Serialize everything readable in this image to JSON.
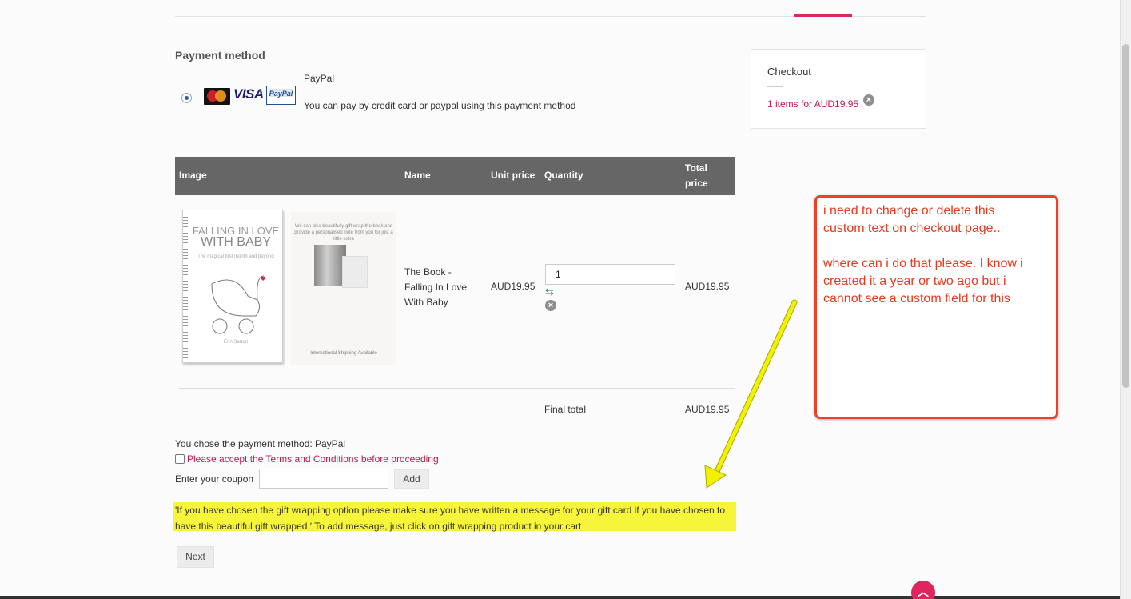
{
  "payment": {
    "title": "Payment method",
    "method_name": "PayPal",
    "method_desc": "You can pay by credit card or paypal using this payment method",
    "logos": {
      "mastercard": "MasterCard",
      "visa": "VISA",
      "paypal": "PayPal"
    }
  },
  "checkout_box": {
    "title": "Checkout",
    "items": "1 items for AUD19.95"
  },
  "table": {
    "headers": {
      "image": "Image",
      "name": "Name",
      "unit_price": "Unit price",
      "quantity": "Quantity",
      "total_line1": "Total",
      "total_line2": "price"
    },
    "row": {
      "name_lines": [
        "The Book -",
        "Falling In Love",
        "With Baby"
      ],
      "unit_price": "AUD19.95",
      "quantity": "1",
      "total": "AUD19.95",
      "cover": {
        "title1": "FALLING IN LOVE",
        "title2": "WITH BABY",
        "subtitle": "The magical first month and beyond",
        "author": "Erin Sartori"
      },
      "gift": {
        "text": "We can also beautifully gift wrap the book and provide a personalised note from you for just a little extra",
        "footer": "International Shipping Available"
      }
    },
    "final_label": "Final total",
    "final_value": "AUD19.95"
  },
  "form": {
    "chose_text": "You chose the payment method: PayPal",
    "terms_label": "Please accept the Terms and Conditions before proceeding",
    "coupon_label": "Enter your coupon",
    "coupon_value": "",
    "add_label": "Add",
    "next_label": "Next"
  },
  "highlight": {
    "line1": "'If you have chosen the gift wrapping option please make sure you have written a message for your gift card if you have chosen to",
    "line2": "have this beautiful gift wrapped.' To add message, just click on gift wrapping product in your cart"
  },
  "annotation": {
    "line1": "i need to change or delete this",
    "line2": "custom text on checkout page..",
    "line3": "where can i do that please. I know i",
    "line4": "created it a year or two ago but i",
    "line5": "cannot see a custom field for this"
  },
  "icons": {
    "remove": "remove-circle-icon",
    "refresh": "refresh-icon",
    "scroll_top": "chevron-up-icon"
  },
  "colors": {
    "accent": "#e0245e",
    "link": "#c4184c",
    "table_header": "#666666",
    "highlight": "#f7f53a",
    "annotation": "#ee3f27",
    "arrow": "#f2f200"
  }
}
